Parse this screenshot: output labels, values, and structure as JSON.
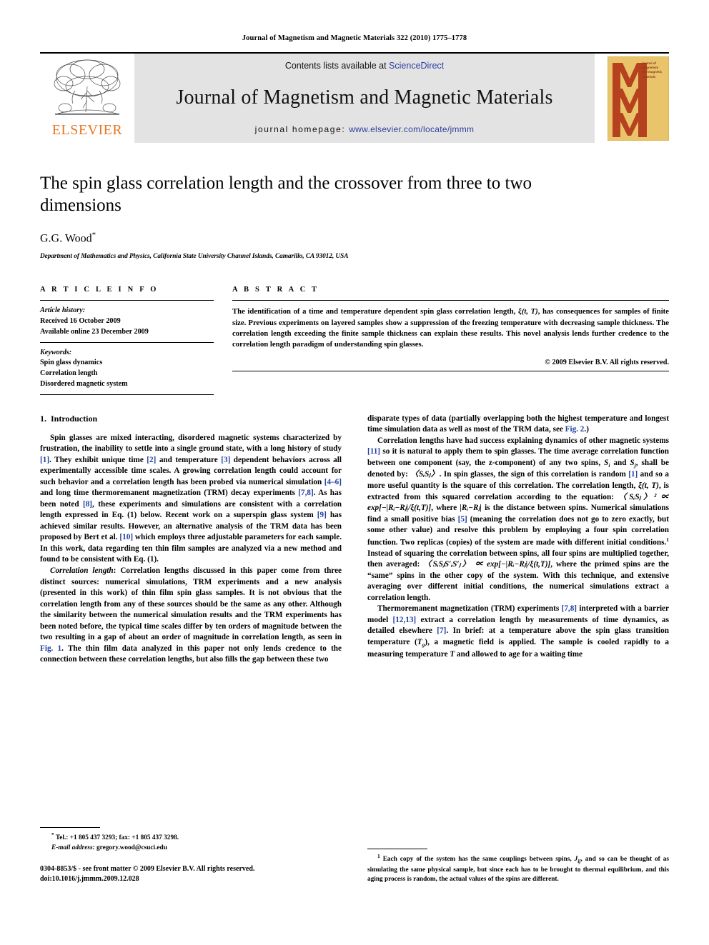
{
  "running_head": "Journal of Magnetism and Magnetic Materials 322 (2010) 1775–1778",
  "masthead": {
    "contents_prefix": "Contents lists available at ",
    "contents_link": "ScienceDirect",
    "journal_title": "Journal of Magnetism and Magnetic Materials",
    "homepage_prefix": "journal homepage: ",
    "homepage_url": "www.elsevier.com/locate/jmmm",
    "publisher_wordmark": "ELSEVIER",
    "cover_letters": "MMM",
    "cover_title_lines": "journal of magnetism and magnetic materials",
    "link_color": "#2b3f9e",
    "elsevier_orange": "#E87722",
    "cover_background": "#e9c46a",
    "cover_ink": "#b5411f",
    "masthead_background": "#e3e3e3"
  },
  "title": "The spin glass correlation length and the crossover from three to two dimensions",
  "author": {
    "name": "G.G. Wood",
    "marker": "*"
  },
  "affiliation": "Department of Mathematics and Physics, California State University Channel Islands, Camarillo, CA 93012, USA",
  "article_info": {
    "heading": "A R T I C L E   I N F O",
    "history_label": "Article history:",
    "history_items": [
      "Received 16 October 2009",
      "Available online 23 December 2009"
    ],
    "keywords_label": "Keywords:",
    "keywords": [
      "Spin glass dynamics",
      "Correlation length",
      "Disordered magnetic system"
    ]
  },
  "abstract": {
    "heading": "A B S T R A C T",
    "text_before_xi": "The identification of a time and temperature dependent spin glass correlation length, ",
    "xi_symbol": "ξ(t, T)",
    "text_after_xi": ", has consequences for samples of finite size. Previous experiments on layered samples show a suppression of the freezing temperature with decreasing sample thickness. The correlation length exceeding the finite sample thickness can explain these results. This novel analysis lends further credence to the correlation length paradigm of understanding spin glasses.",
    "copyright": "© 2009 Elsevier B.V. All rights reserved."
  },
  "intro": {
    "section_number": "1.",
    "section_title": "Introduction"
  },
  "left_column": {
    "p1_a": "Spin glasses are mixed interacting, disordered magnetic systems characterized by frustration, the inability to settle into a single ground state, with a long history of study ",
    "c1": "[1]",
    "p1_b": ". They exhibit unique time ",
    "c2": "[2]",
    "p1_c": " and temperature ",
    "c3": "[3]",
    "p1_d": " dependent behaviors across all experimentally accessible time scales. A growing correlation length could account for such behavior and a correlation length has been probed via numerical simulation ",
    "c4": "[4–6]",
    "p1_e": " and long time thermoremanent magnetization (TRM) decay experiments ",
    "c5": "[7,8]",
    "p1_f": ". As has been noted ",
    "c6": "[8]",
    "p1_g": ", these experiments and simulations are consistent with a correlation length expressed in Eq. (1) below. Recent work on a superspin glass system ",
    "c7": "[9]",
    "p1_h": " has achieved similar results. However, an alternative analysis of the TRM data has been proposed by Bert et al. ",
    "c8": "[10]",
    "p1_i": " which employs three adjustable parameters for each sample. In this work, data regarding ten thin film samples are analyzed via a new method and found to be consistent with Eq. (1).",
    "p2_label": "Correlation length",
    "p2_a": ": Correlation lengths discussed in this paper come from three distinct sources: numerical simulations, TRM experiments and a new analysis (presented in this work) of thin film spin glass samples. It is not obvious that the correlation length from any of these sources should be the same as any other. Although the similarity between the numerical simulation results and the TRM experiments has been noted before, the typical time scales differ by ten orders of magnitude between the two resulting in a gap of about an order of magnitude in correlation length, as seen in ",
    "fig1": "Fig. 1",
    "p2_b": ". The thin film data analyzed in this paper not only lends credence to the connection between these correlation lengths, but also fills the gap between these two",
    "footnote_marker": "*",
    "footnote_tel": "Tel.: +1 805 437 3293; fax: +1 805 437 3298.",
    "footnote_email_label": "E-mail address:",
    "footnote_email": "gregory.wood@csuci.edu",
    "issn_line": "0304-8853/$ - see front matter © 2009 Elsevier B.V. All rights reserved.",
    "doi_line": "doi:10.1016/j.jmmm.2009.12.028"
  },
  "right_column": {
    "p3_a": "disparate types of data (partially overlapping both the highest temperature and longest time simulation data as well as most of the TRM data, see ",
    "fig2": "Fig. 2",
    "p3_b": ".)",
    "p4_a": "Correlation lengths have had success explaining dynamics of other magnetic systems ",
    "c11": "[11]",
    "p4_b": " so it is natural to apply them to spin glasses. The time average correlation function between one component (say, the z-component) of any two spins, ",
    "spin_i": "S",
    "spin_i_sub": "i",
    "p4_c": " and ",
    "spin_j": "S",
    "spin_j_sub": "j",
    "p4_d": ", shall be denoted by: ",
    "corr_braket": "〈SᵢSⱼ〉",
    "p4_e": ". In spin glasses, the sign of this correlation is random ",
    "c1b": "[1]",
    "p4_f": " and so a more useful quantity is the square of this correlation. The correlation length, ",
    "xi": "ξ(t, T)",
    "p4_g": ", is extracted from this squared correlation according to the equation: ",
    "eq1": "〈SᵢSⱼ〉² ∝ exp[−|Rᵢ−Rⱼ|/ξ(t,T)]",
    "p4_h": ", where ",
    "dist": "|Rᵢ−Rⱼ|",
    "p4_i": " is the distance between spins. Numerical simulations find a small positive bias ",
    "c5b": "[5]",
    "p4_j": " (meaning the correlation does not go to zero exactly, but some other value) and resolve this problem by employing a four spin correlation function. Two replicas (copies) of the system are made with different initial conditions.",
    "fn_marker": "1",
    "p4_k": " Instead of squaring the correlation between spins, all four spins are multiplied together, then averaged: ",
    "eq2": "〈SᵢSⱼS′ᵢS′ⱼ〉 ∝ exp[−|Rᵢ−Rⱼ|/ξ(t,T)]",
    "p4_l": ", where the primed spins are the “same” spins in the other copy of the system. With this technique, and extensive averaging over different initial conditions, the numerical simulations extract a correlation length.",
    "p5_a": "Thermoremanent magnetization (TRM) experiments ",
    "c78": "[7,8]",
    "p5_b": " interpreted with a barrier model ",
    "c1213": "[12,13]",
    "p5_c": " extract a correlation length by measurements of time dynamics, as detailed elsewhere ",
    "c7b": "[7]",
    "p5_d": ". In brief: at a temperature above the spin glass transition temperature (",
    "tg": "T",
    "tg_sub": "g",
    "p5_e": "), a magnetic field is applied. The sample is cooled rapidly to a measuring temperature ",
    "temp_t": "T",
    "p5_f": " and allowed to age for a waiting time",
    "footnote_marker": "1",
    "footnote_a": " Each copy of the system has the same couplings between spins, ",
    "footnote_j": "J",
    "footnote_j_sub": "ij",
    "footnote_b": ", and so can be thought of as simulating the same physical sample, but since each has to be brought to thermal equilibrium, and this aging process is random, the actual values of the spins are different."
  }
}
